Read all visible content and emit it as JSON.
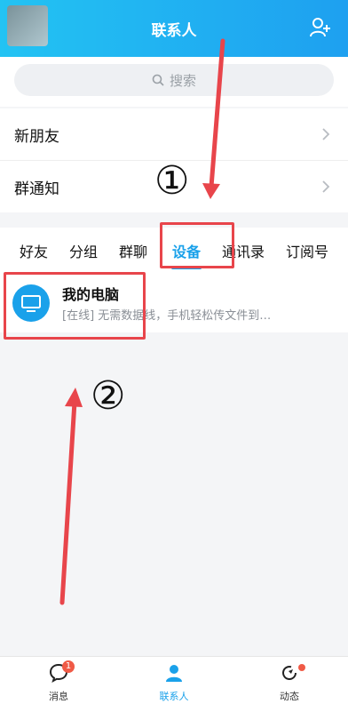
{
  "header": {
    "title": "联系人"
  },
  "search": {
    "placeholder": "搜索"
  },
  "list": {
    "new_friends": "新朋友",
    "group_notice": "群通知"
  },
  "tabs": [
    "好友",
    "分组",
    "群聊",
    "设备",
    "通讯录",
    "订阅号"
  ],
  "active_tab": "设备",
  "device": {
    "name": "我的电脑",
    "status": "[在线] 无需数据线，手机轻松传文件到…"
  },
  "annotations": {
    "label_1": "①",
    "label_2": "②"
  },
  "bottom_nav": [
    {
      "label": "消息",
      "badge": "1"
    },
    {
      "label": "联系人"
    },
    {
      "label": "动态"
    }
  ],
  "colors": {
    "accent": "#1aa1ea",
    "header_start": "#23c3f3",
    "annotation": "#e8454b",
    "badge": "#f05a46"
  }
}
